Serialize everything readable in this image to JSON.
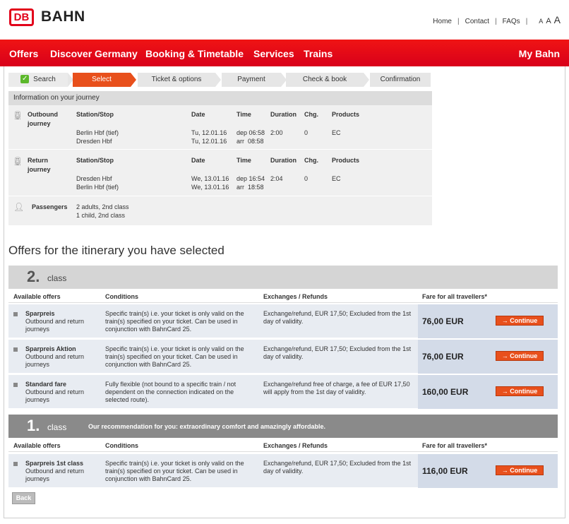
{
  "brand": {
    "logo": "DB",
    "name": "BAHN"
  },
  "toplinks": {
    "home": "Home",
    "contact": "Contact",
    "faqs": "FAQs",
    "sizes": [
      "A",
      "A",
      "A"
    ]
  },
  "nav": {
    "items": [
      "Offers",
      "Discover Germany",
      "Booking & Timetable",
      "Services",
      "Trains"
    ],
    "mybahn": "My Bahn"
  },
  "steps": [
    "Search",
    "Select",
    "Ticket & options",
    "Payment",
    "Check & book",
    "Confirmation"
  ],
  "info": {
    "title": "Information on your journey",
    "outbound": {
      "label1": "Outbound",
      "label2": "journey",
      "headers": [
        "Station/Stop",
        "Date",
        "Time",
        "Duration",
        "Chg.",
        "Products"
      ],
      "from": "Berlin Hbf (tief)",
      "to": "Dresden Hbf",
      "date1": "Tu, 12.01.16",
      "date2": "Tu, 12.01.16",
      "time1": "dep 06:58",
      "time2": "arr  08:58",
      "duration": "2:00",
      "changes": "0",
      "product": "EC"
    },
    "return": {
      "label1": "Return",
      "label2": "journey",
      "from": "Dresden Hbf",
      "to": "Berlin Hbf (tief)",
      "date1": "We, 13.01.16",
      "date2": "We, 13.01.16",
      "time1": "dep 16:54",
      "time2": "arr  18:58",
      "duration": "2:04",
      "changes": "0",
      "product": "EC"
    },
    "passengers": {
      "label": "Passengers",
      "line1": "2 adults, 2nd class",
      "line2": "1 child, 2nd class"
    }
  },
  "offers_title": "Offers for the itinerary you have selected",
  "table_headers": {
    "offers": "Available offers",
    "conditions": "Conditions",
    "exchanges": "Exchanges / Refunds",
    "fare": "Fare for all travellers*"
  },
  "second": {
    "num": "2.",
    "label": "class",
    "rows": [
      {
        "name": "Sparpreis",
        "sub1": "Outbound and return",
        "sub2": "journeys",
        "cond1": "Specific train(s) i.e. your ticket is only valid on the",
        "cond2": "train(s) specified on your ticket. Can be used in",
        "cond3": "conjunction with BahnCard 25.",
        "ex1": "Exchange/refund, EUR 17,50; Excluded from the 1st",
        "ex2": "day of validity.",
        "price": "76,00 EUR"
      },
      {
        "name": "Sparpreis Aktion",
        "sub1": "Outbound and return",
        "sub2": "journeys",
        "cond1": "Specific train(s) i.e. your ticket is only valid on the",
        "cond2": "train(s) specified on your ticket. Can be used in",
        "cond3": "conjunction with BahnCard 25.",
        "ex1": "Exchange/refund, EUR 17,50; Excluded from the 1st",
        "ex2": "day of validity.",
        "price": "76,00 EUR"
      },
      {
        "name": "Standard fare",
        "sub1": "Outbound and return",
        "sub2": "journeys",
        "cond1": "Fully flexible (not bound to a specific train / not",
        "cond2": "dependent on the connection indicated on the",
        "cond3": "selected route).",
        "ex1": "Exchange/refund free of charge, a fee of EUR 17,50",
        "ex2": "will apply from the 1st day of validity.",
        "price": "160,00 EUR"
      }
    ]
  },
  "first": {
    "num": "1.",
    "label": "class",
    "recommendation": "Our recommendation for you: extraordinary comfort and amazingly affordable.",
    "rows": [
      {
        "name": "Sparpreis 1st class",
        "sub1": "Outbound and return",
        "sub2": "journeys",
        "cond1": "Specific train(s) i.e. your ticket is only valid on the",
        "cond2": "train(s) specified on your ticket. Can be used in",
        "cond3": "conjunction with BahnCard 25.",
        "ex1": "Exchange/refund, EUR 17,50; Excluded from the 1st",
        "ex2": "day of validity.",
        "price": "116,00 EUR"
      }
    ]
  },
  "continue_label": "→ Continue",
  "back_label": "Back",
  "colors": {
    "brand_red": "#e2001a",
    "accent_orange": "#e8501c"
  }
}
